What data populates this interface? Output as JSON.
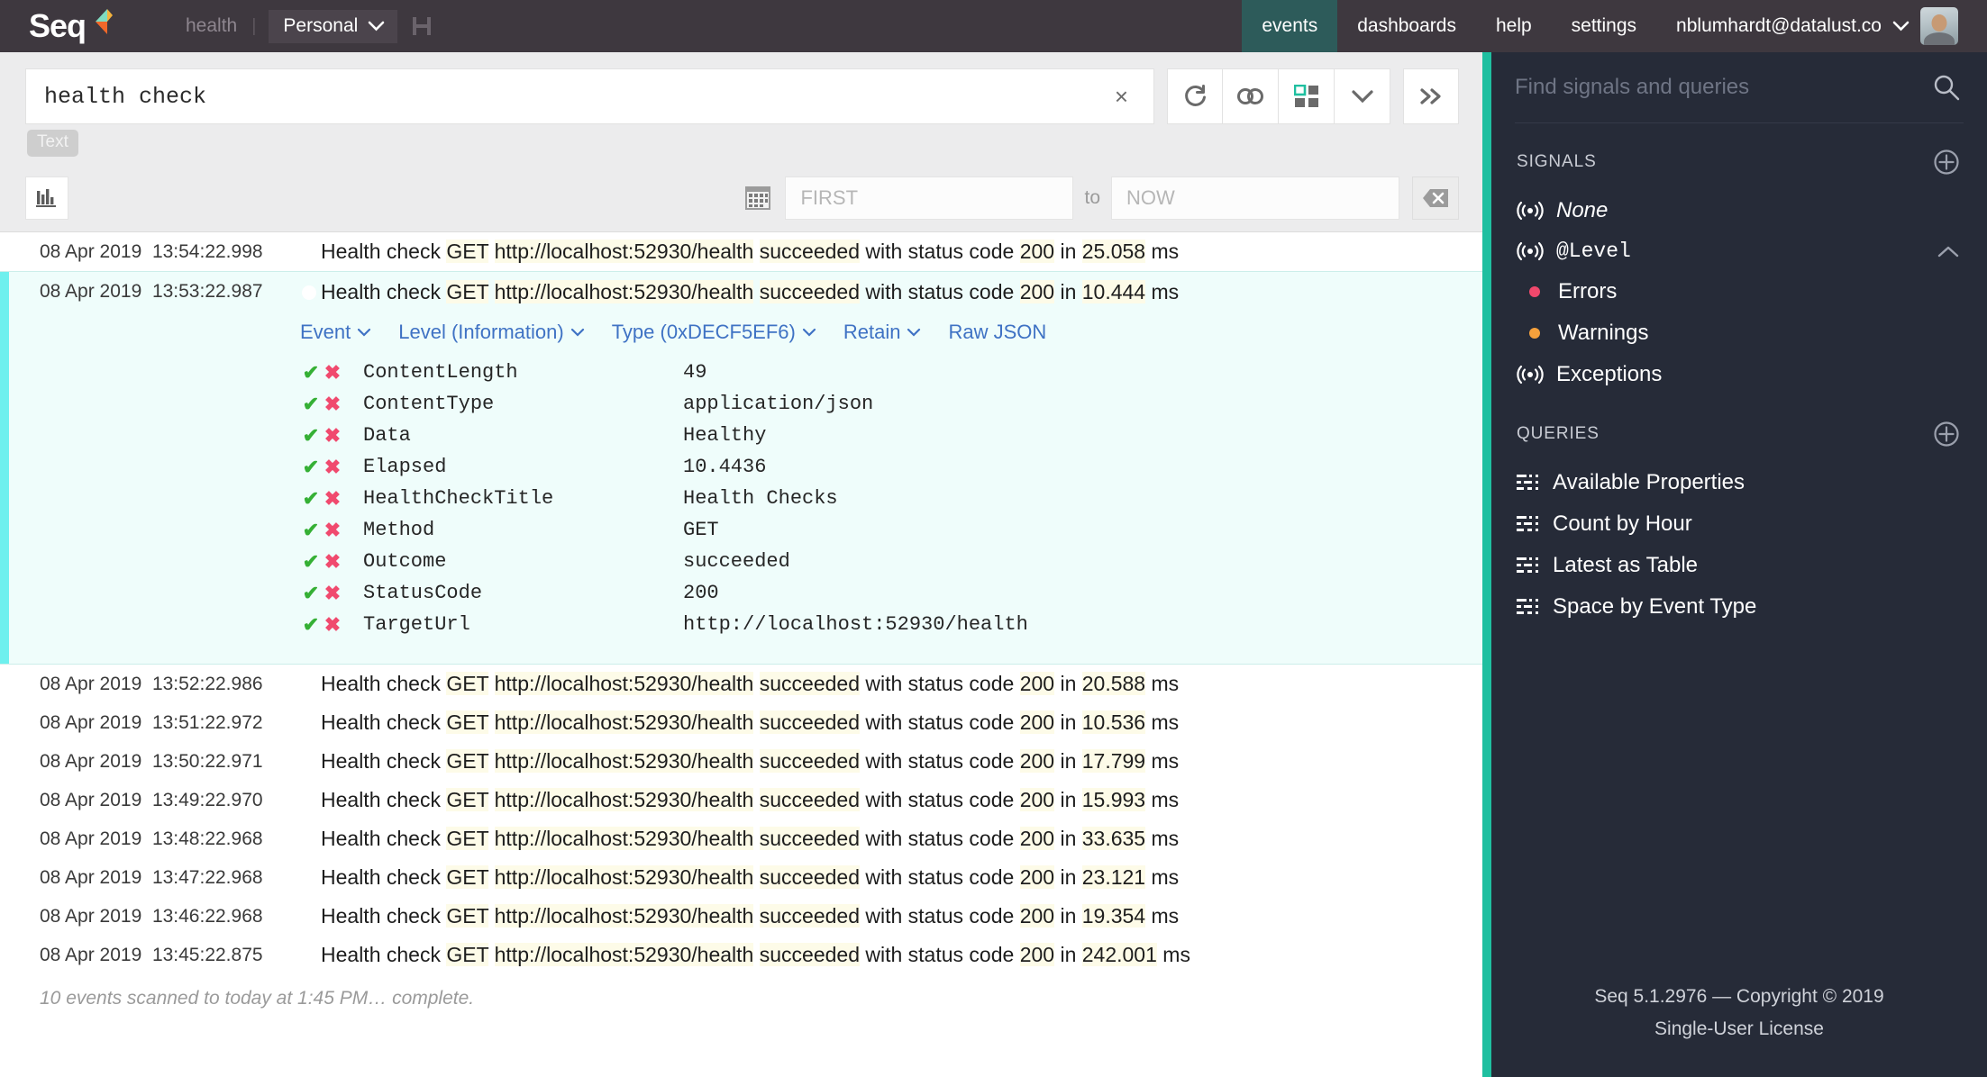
{
  "header": {
    "brand": "Seq",
    "breadcrumb_context": "health",
    "breadcrumb_separator": "|",
    "workspace": "Personal",
    "nav": [
      {
        "label": "events",
        "active": true
      },
      {
        "label": "dashboards",
        "active": false
      },
      {
        "label": "help",
        "active": false
      },
      {
        "label": "settings",
        "active": false
      }
    ],
    "user": "nblumhardt@datalust.co",
    "accent_teal": "#2d5b5a",
    "bar_bg": "#3e383f"
  },
  "search": {
    "query": "health check",
    "clear_label": "×",
    "mode_badge": "Text",
    "buttons": [
      {
        "name": "refresh",
        "title": "Refresh"
      },
      {
        "name": "link",
        "title": "Copy link"
      },
      {
        "name": "layout",
        "title": "Display options"
      },
      {
        "name": "chevron",
        "title": "More"
      },
      {
        "name": "expand",
        "title": "Expand"
      }
    ]
  },
  "filter": {
    "chart_button": "chart",
    "calendar_button": "calendar",
    "from_placeholder": "FIRST",
    "to_label": "to",
    "to_placeholder": "NOW",
    "clear_button": "clear-range"
  },
  "events": {
    "rows_above": [
      {
        "date": "08 Apr 2019",
        "time": "13:54:22.998",
        "prefix": "Health check ",
        "method": "GET",
        "url": "http://localhost:52930/health",
        "outcome": "succeeded",
        "mid": " with status code ",
        "status": "200",
        "in": " in ",
        "elapsed": "25.058",
        "ms": " ms"
      }
    ],
    "selected": {
      "date": "08 Apr 2019",
      "time": "13:53:22.987",
      "prefix": "Health check ",
      "method": "GET",
      "url": "http://localhost:52930/health",
      "outcome": "succeeded",
      "mid": " with status code ",
      "status": "200",
      "in": " in ",
      "elapsed": "10.444",
      "ms": " ms",
      "toolbar": [
        {
          "label": "Event",
          "caret": true
        },
        {
          "label": "Level (Information)",
          "caret": true
        },
        {
          "label": "Type (0xDECF5EF6)",
          "caret": true
        },
        {
          "label": "Retain",
          "caret": true
        },
        {
          "label": "Raw JSON",
          "caret": false
        }
      ],
      "properties": [
        {
          "name": "ContentLength",
          "value": "49"
        },
        {
          "name": "ContentType",
          "value": "application/json"
        },
        {
          "name": "Data",
          "value": "Healthy"
        },
        {
          "name": "Elapsed",
          "value": "10.4436"
        },
        {
          "name": "HealthCheckTitle",
          "value": "Health Checks"
        },
        {
          "name": "Method",
          "value": "GET"
        },
        {
          "name": "Outcome",
          "value": "succeeded"
        },
        {
          "name": "StatusCode",
          "value": "200"
        },
        {
          "name": "TargetUrl",
          "value": "http://localhost:52930/health"
        }
      ],
      "include_icon": "✔",
      "exclude_icon": "✖"
    },
    "rows_below": [
      {
        "date": "08 Apr 2019",
        "time": "13:52:22.986",
        "prefix": "Health check ",
        "method": "GET",
        "url": "http://localhost:52930/health",
        "outcome": "succeeded",
        "mid": " with status code ",
        "status": "200",
        "in": " in ",
        "elapsed": "20.588",
        "ms": " ms"
      },
      {
        "date": "08 Apr 2019",
        "time": "13:51:22.972",
        "prefix": "Health check ",
        "method": "GET",
        "url": "http://localhost:52930/health",
        "outcome": "succeeded",
        "mid": " with status code ",
        "status": "200",
        "in": " in ",
        "elapsed": "10.536",
        "ms": " ms"
      },
      {
        "date": "08 Apr 2019",
        "time": "13:50:22.971",
        "prefix": "Health check ",
        "method": "GET",
        "url": "http://localhost:52930/health",
        "outcome": "succeeded",
        "mid": " with status code ",
        "status": "200",
        "in": " in ",
        "elapsed": "17.799",
        "ms": " ms"
      },
      {
        "date": "08 Apr 2019",
        "time": "13:49:22.970",
        "prefix": "Health check ",
        "method": "GET",
        "url": "http://localhost:52930/health",
        "outcome": "succeeded",
        "mid": " with status code ",
        "status": "200",
        "in": " in ",
        "elapsed": "15.993",
        "ms": " ms"
      },
      {
        "date": "08 Apr 2019",
        "time": "13:48:22.968",
        "prefix": "Health check ",
        "method": "GET",
        "url": "http://localhost:52930/health",
        "outcome": "succeeded",
        "mid": " with status code ",
        "status": "200",
        "in": " in ",
        "elapsed": "33.635",
        "ms": " ms"
      },
      {
        "date": "08 Apr 2019",
        "time": "13:47:22.968",
        "prefix": "Health check ",
        "method": "GET",
        "url": "http://localhost:52930/health",
        "outcome": "succeeded",
        "mid": " with status code ",
        "status": "200",
        "in": " in ",
        "elapsed": "23.121",
        "ms": " ms"
      },
      {
        "date": "08 Apr 2019",
        "time": "13:46:22.968",
        "prefix": "Health check ",
        "method": "GET",
        "url": "http://localhost:52930/health",
        "outcome": "succeeded",
        "mid": " with status code ",
        "status": "200",
        "in": " in ",
        "elapsed": "19.354",
        "ms": " ms"
      },
      {
        "date": "08 Apr 2019",
        "time": "13:45:22.875",
        "prefix": "Health check ",
        "method": "GET",
        "url": "http://localhost:52930/health",
        "outcome": "succeeded",
        "mid": " with status code ",
        "status": "200",
        "in": " in ",
        "elapsed": "242.001",
        "ms": " ms"
      }
    ],
    "status_text": "10 events scanned to today at 1:45 PM… complete."
  },
  "sidebar": {
    "find_placeholder": "Find signals and queries",
    "signals_heading": "SIGNALS",
    "signals": [
      {
        "label": "None",
        "icon": "signal-icon",
        "italic": true,
        "mono": false,
        "collapsible": false
      },
      {
        "label": "@Level",
        "icon": "signal-icon",
        "italic": false,
        "mono": true,
        "collapsible": true
      }
    ],
    "levels": [
      {
        "label": "Errors",
        "color": "#f0486c"
      },
      {
        "label": "Warnings",
        "color": "#f5a13c"
      }
    ],
    "exceptions": {
      "label": "Exceptions",
      "icon": "signal-icon"
    },
    "queries_heading": "QUERIES",
    "queries": [
      {
        "label": "Available Properties"
      },
      {
        "label": "Count by Hour"
      },
      {
        "label": "Latest as Table"
      },
      {
        "label": "Space by Event Type"
      }
    ],
    "footer_copyright": "Seq 5.1.2976 — Copyright © 2019",
    "footer_license": "Single-User License",
    "accent_bar": "#1fbfa0",
    "bg": "#262b38"
  }
}
